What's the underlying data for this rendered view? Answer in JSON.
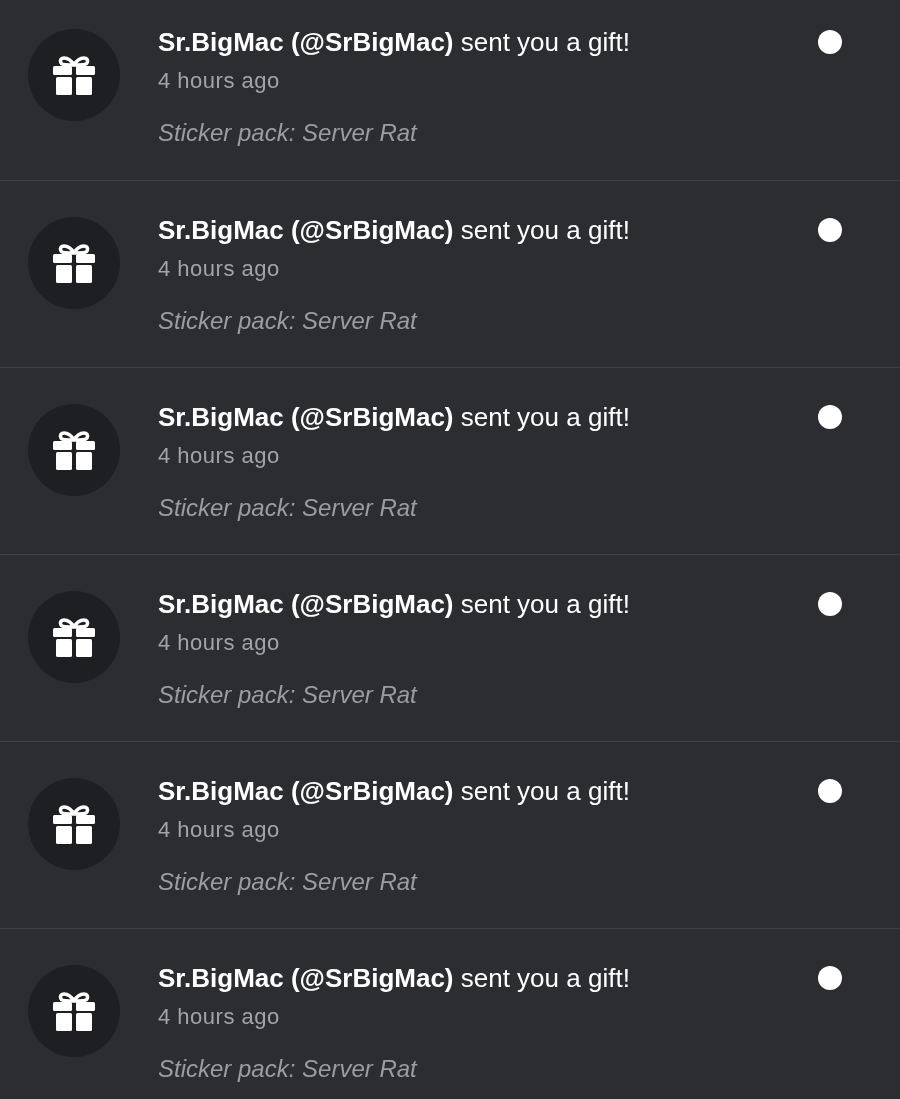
{
  "notifications": [
    {
      "title": "**Sr.BigMac (@SrBigMac)** sent you a gift!",
      "time": "4 hours ago",
      "detail": "Sticker pack: Server Rat",
      "unread": true
    },
    {
      "title": "**Sr.BigMac (@SrBigMac)** sent you a gift!",
      "time": "4 hours ago",
      "detail": "Sticker pack: Server Rat",
      "unread": true
    },
    {
      "title": "**Sr.BigMac (@SrBigMac)** sent you a gift!",
      "time": "4 hours ago",
      "detail": "Sticker pack: Server Rat",
      "unread": true
    },
    {
      "title": "**Sr.BigMac (@SrBigMac)** sent you a gift!",
      "time": "4 hours ago",
      "detail": "Sticker pack: Server Rat",
      "unread": true
    },
    {
      "title": "**Sr.BigMac (@SrBigMac)** sent you a gift!",
      "time": "4 hours ago",
      "detail": "Sticker pack: Server Rat",
      "unread": true
    },
    {
      "title": "**Sr.BigMac (@SrBigMac)** sent you a gift!",
      "time": "4 hours ago",
      "detail": "Sticker pack: Server Rat",
      "unread": true
    }
  ]
}
